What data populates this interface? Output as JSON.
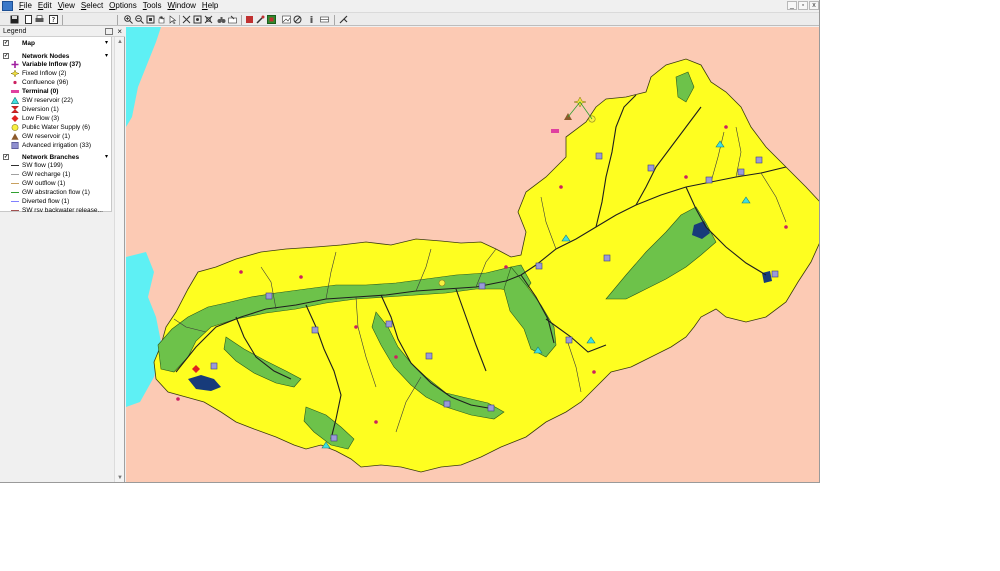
{
  "menubar": {
    "items": [
      {
        "key": "F",
        "rest": "ile"
      },
      {
        "key": "E",
        "rest": "dit"
      },
      {
        "key": "V",
        "rest": "iew"
      },
      {
        "key": "S",
        "rest": "elect"
      },
      {
        "key": "O",
        "rest": "ptions"
      },
      {
        "key": "T",
        "rest": "ools"
      },
      {
        "key": "W",
        "rest": "indow"
      },
      {
        "key": "H",
        "rest": "elp"
      }
    ],
    "minimize": "_",
    "restore": "▫",
    "close": "x"
  },
  "legend": {
    "title": "Legend",
    "close": "×",
    "map_group": "Map",
    "nodes_group": "Network Nodes",
    "branches_group": "Network Branches",
    "nodes": [
      {
        "label": "Variable Inflow (37)",
        "bold": true,
        "icon": "plus-icon",
        "color": "#a020a0"
      },
      {
        "label": "Fixed Inflow (2)",
        "bold": false,
        "icon": "star-icon",
        "color": "#c8b400"
      },
      {
        "label": "Confluence (96)",
        "bold": false,
        "icon": "dot-icon",
        "color": "#cc2060"
      },
      {
        "label": "Terminal (0)",
        "bold": true,
        "icon": "rectangle-icon",
        "color": "#e040a0"
      },
      {
        "label": "SW reservoir (22)",
        "bold": false,
        "icon": "triangle-icon",
        "color": "#40e0e0"
      },
      {
        "label": "Diversion (1)",
        "bold": false,
        "icon": "hourglass-icon",
        "color": "#e02020"
      },
      {
        "label": "Low Flow (3)",
        "bold": false,
        "icon": "diamond-icon",
        "color": "#e02020"
      },
      {
        "label": "Public Water Supply (6)",
        "bold": false,
        "icon": "circle-icon",
        "color": "#f8f040"
      },
      {
        "label": "GW reservoir (1)",
        "bold": false,
        "icon": "triangle-icon",
        "color": "#8b5a2b"
      },
      {
        "label": "Advanced irrigation (33)",
        "bold": false,
        "icon": "square-icon",
        "color": "#9090d0"
      }
    ],
    "branches": [
      {
        "label": "SW flow (199)",
        "color": "#303030"
      },
      {
        "label": "GW recharge (1)",
        "color": "#a0a0a0"
      },
      {
        "label": "GW outflow (1)",
        "color": "#c8a060"
      },
      {
        "label": "GW abstraction flow (1)",
        "color": "#30a030"
      },
      {
        "label": "Diverted flow (1)",
        "color": "#8080ff"
      },
      {
        "label": "SW rsv backwater release...",
        "color": "#a05050"
      }
    ]
  },
  "colors": {
    "sea": "#5ef0f4",
    "land": "#fccab4",
    "catchment": "#fefe20",
    "floodplain": "#6dc24a",
    "lake": "#173b7a",
    "river": "#1e1e1e",
    "irrigation": "#9a9ad8"
  }
}
